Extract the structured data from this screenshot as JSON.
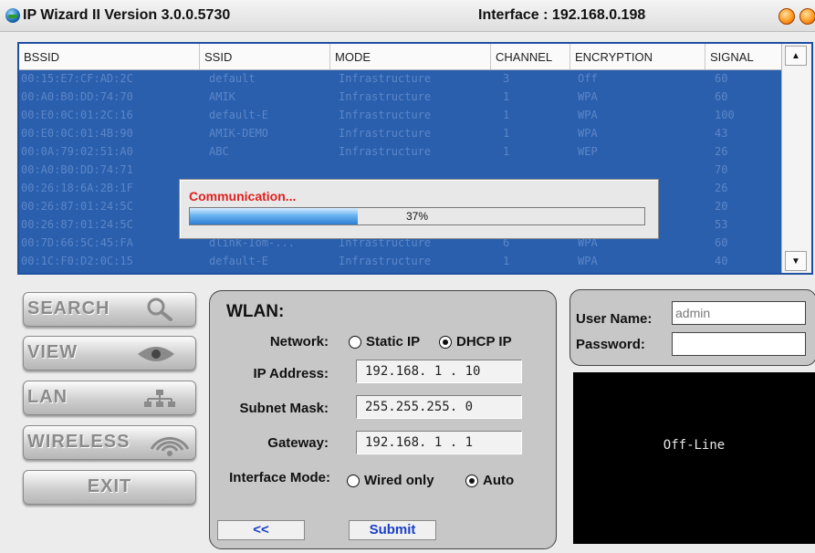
{
  "window": {
    "title": "IP Wizard II  Version 3.0.0.5730",
    "interface_label": "Interface : 192.168.0.198"
  },
  "list": {
    "columns": [
      "BSSID",
      "SSID",
      "MODE",
      "CHANNEL",
      "ENCRYPTION",
      "SIGNAL"
    ],
    "rows": [
      [
        "00:15:E7:CF:AD:2C",
        "default",
        "Infrastructure",
        "3",
        "Off",
        "60"
      ],
      [
        "00:A0:B0:DD:74:70",
        "AMIK",
        "Infrastructure",
        "1",
        "WPA",
        "60"
      ],
      [
        "00:E0:0C:01:2C:16",
        "default-E",
        "Infrastructure",
        "1",
        "WPA",
        "100"
      ],
      [
        "00:E0:0C:01:4B:90",
        "AMIK-DEMO",
        "Infrastructure",
        "1",
        "WPA",
        "43"
      ],
      [
        "00:0A:79:02:51:A0",
        "ABC",
        "Infrastructure",
        "1",
        "WEP",
        "26"
      ],
      [
        "00:A0:B0:DD:74:71",
        "",
        "",
        "",
        "",
        "70"
      ],
      [
        "00:26:18:6A:2B:1F",
        "",
        "",
        "",
        "",
        "26"
      ],
      [
        "00:26:87:01:24:5C",
        "",
        "",
        "",
        "",
        "20"
      ],
      [
        "00:26:87:01:24:5C",
        "SQA-Ansdra",
        "Infrastructure",
        "1",
        "WEP",
        "53"
      ],
      [
        "00:7D:66:5C:45:FA",
        "dlink-Iom-...",
        "Infrastructure",
        "6",
        "WPA",
        "60"
      ],
      [
        "00:1C:F0:D2:0C:15",
        "default-E",
        "Infrastructure",
        "1",
        "WPA",
        "40"
      ]
    ],
    "scroll_up": "▲",
    "scroll_down": "▼"
  },
  "progress": {
    "label": "Communication...",
    "percent_text": "37%",
    "fraction": 0.37
  },
  "nav": {
    "search": "SEARCH",
    "view": "VIEW",
    "lan": "LAN",
    "wireless": "WIRELESS",
    "exit": "EXIT"
  },
  "wlan": {
    "title": "WLAN:",
    "network_label": "Network:",
    "static_ip": "Static IP",
    "dhcp_ip": "DHCP IP",
    "network_selected": "DHCP IP",
    "ip_label": "IP Address:",
    "ip_value": "192.168. 1 . 10",
    "subnet_label": "Subnet Mask:",
    "subnet_value": "255.255.255. 0",
    "gateway_label": "Gateway:",
    "gateway_value": "192.168. 1 . 1",
    "mode_label": "Interface Mode:",
    "wired_only": "Wired only",
    "auto": "Auto",
    "mode_selected": "Auto",
    "back_button": "<<",
    "submit_button": "Submit"
  },
  "login": {
    "username_label": "User Name:",
    "username_value": "admin",
    "password_label": "Password:",
    "password_value": ""
  },
  "status": {
    "text": "Off-Line"
  },
  "icons": {
    "app": "network-globe-icon",
    "search": "magnifier-icon",
    "view": "eye-icon",
    "lan": "network-tree-icon",
    "wireless": "wifi-signal-icon"
  },
  "colors": {
    "list_selection": "#2a5fae",
    "progress_label": "#e02020",
    "button_text": "#1a3fc8"
  }
}
